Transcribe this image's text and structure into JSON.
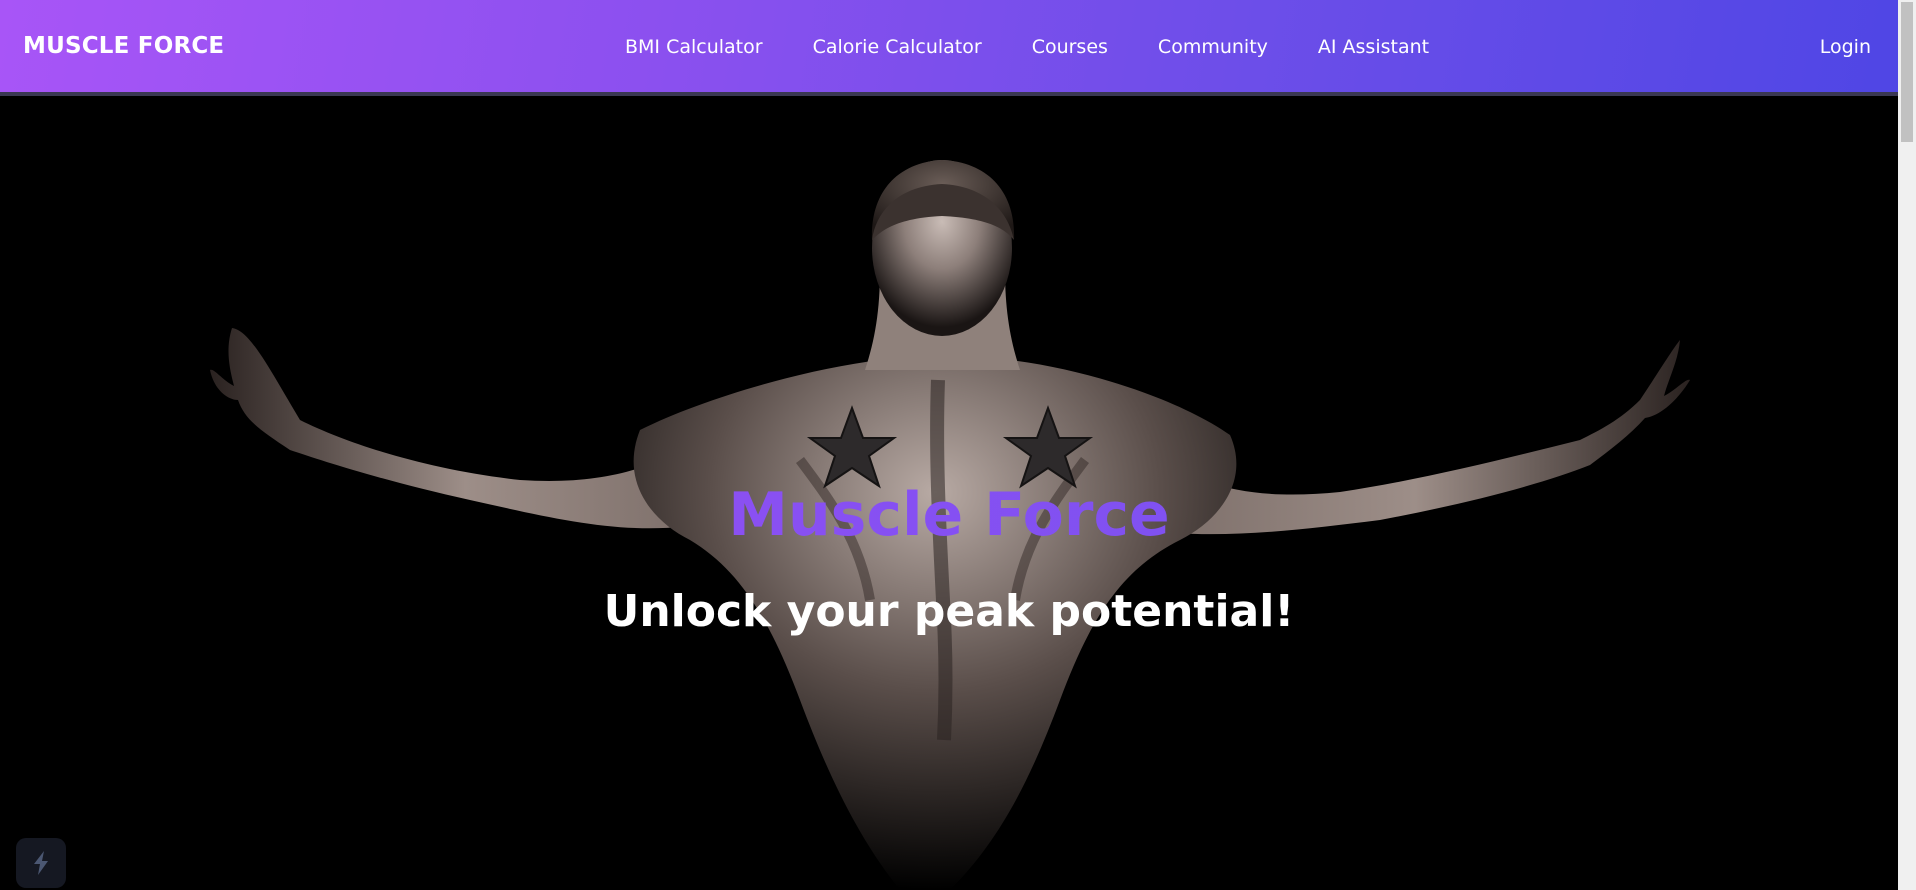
{
  "nav": {
    "brand": "MUSCLE FORCE",
    "links": [
      "BMI Calculator",
      "Calorie Calculator",
      "Courses",
      "Community",
      "AI Assistant"
    ],
    "login": "Login"
  },
  "hero": {
    "title": "Muscle Force",
    "subtitle": "Unlock your peak potential!",
    "image_subject": "muscular-back-with-star-tattoos"
  },
  "colors": {
    "nav_gradient_start": "#a855f7",
    "nav_gradient_end": "#4f46e5",
    "title_gradient_start": "#9b4ff5",
    "title_gradient_end": "#6f52ee",
    "hero_background": "#000000"
  }
}
